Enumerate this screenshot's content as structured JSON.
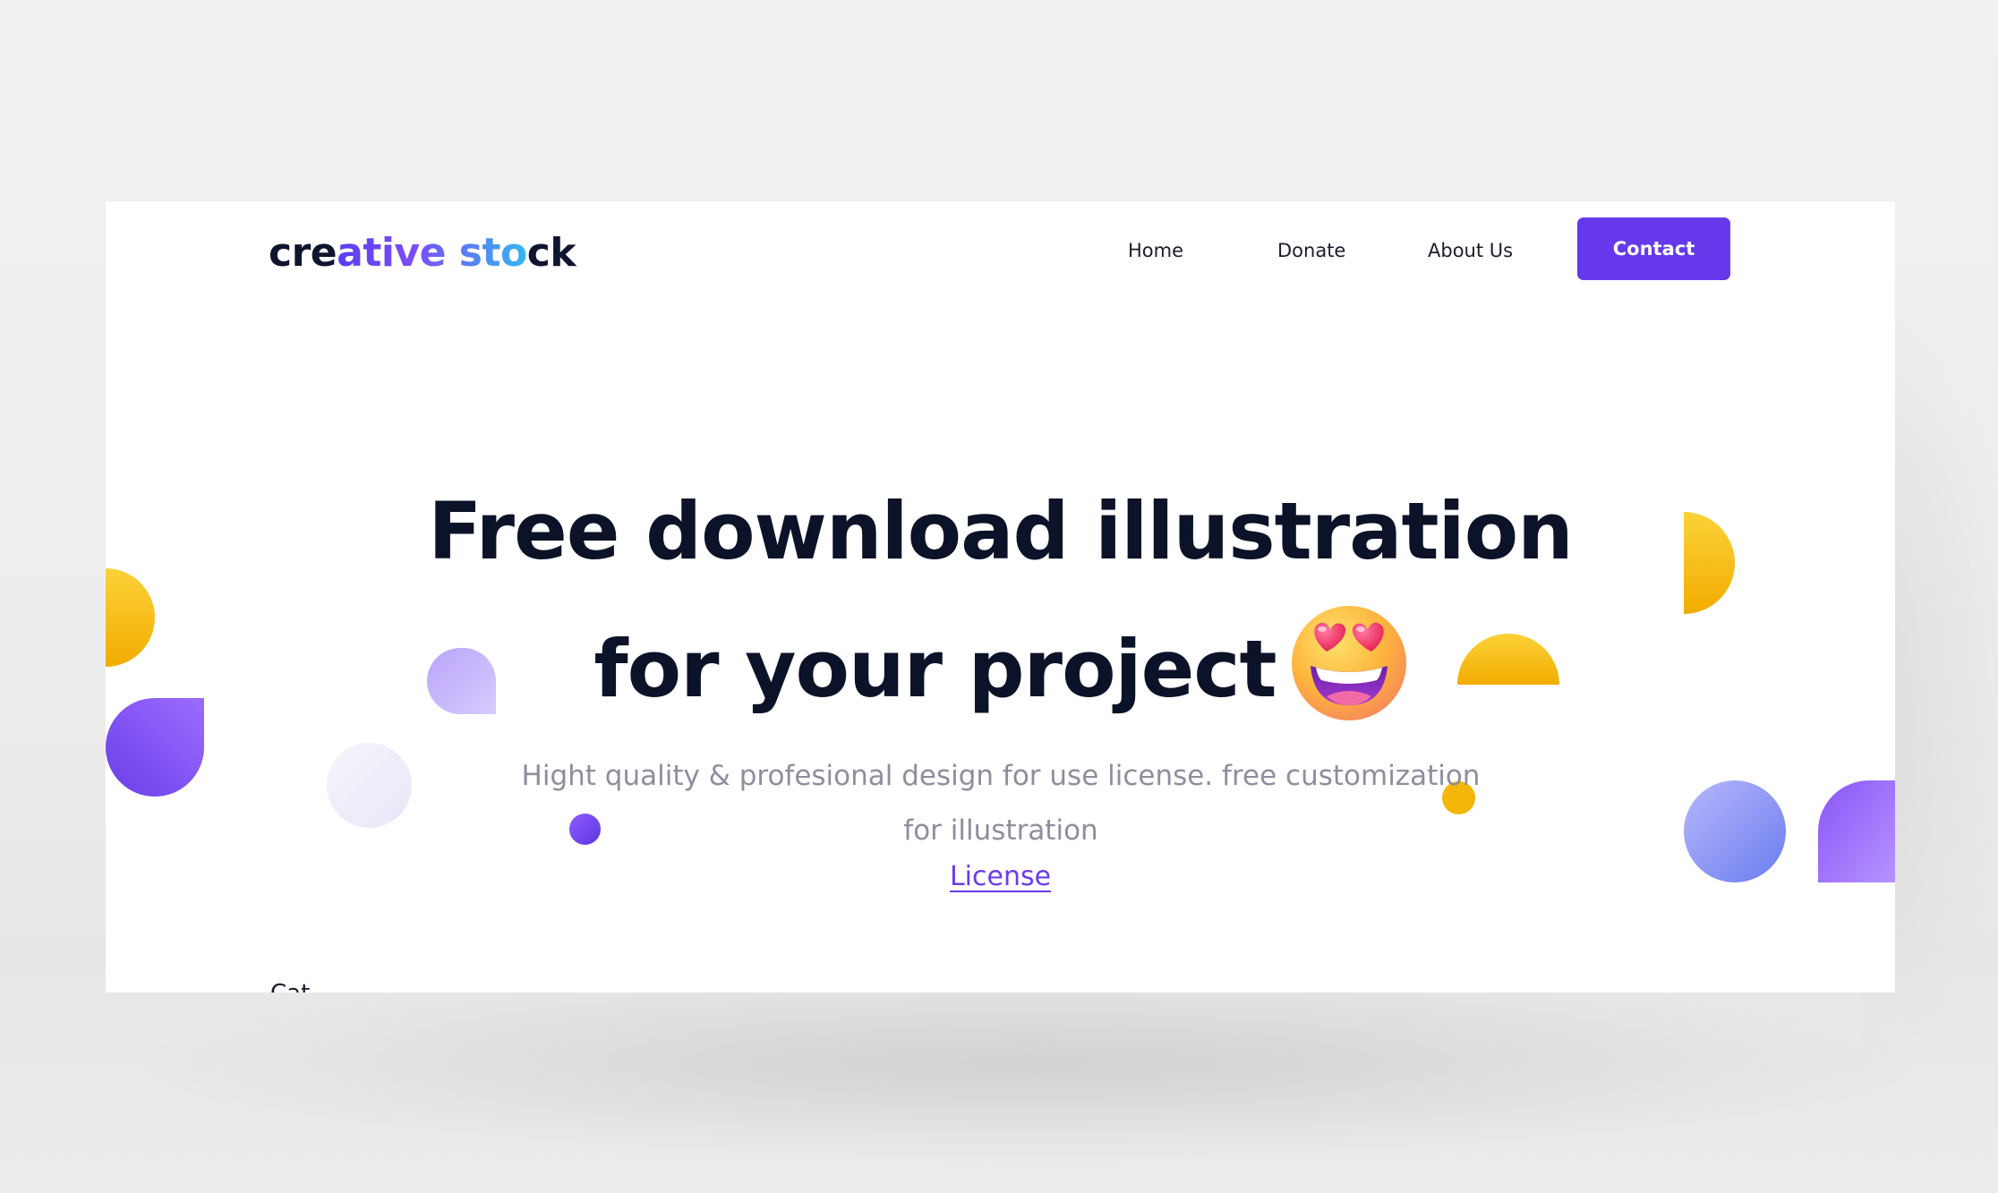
{
  "brand": {
    "logo_part1": "cre",
    "logo_part2": "ative sto",
    "logo_part3": "ck"
  },
  "nav": {
    "items": [
      {
        "label": "Home"
      },
      {
        "label": "Donate"
      },
      {
        "label": "About Us"
      }
    ],
    "cta_label": "Contact"
  },
  "hero": {
    "title_line1": "Free download illustration",
    "title_line2": "for your project",
    "emoji_icon": "smiling-face-with-heart-eyes-icon",
    "subtitle": "Hight quality & profesional design for use license. free customization for illustration",
    "license_link": "License"
  },
  "next_section": {
    "peek_label": "Cat"
  },
  "colors": {
    "accent": "#6638ec",
    "heading": "#0c1228",
    "body_text": "#8d8f9e",
    "yellow_shape": "#f7bb10",
    "purple_shape": "#7a4cf3",
    "lavender_shape": "#c6b6fb",
    "page_background": "#ffffff",
    "outer_background": "#f1f1f1"
  }
}
